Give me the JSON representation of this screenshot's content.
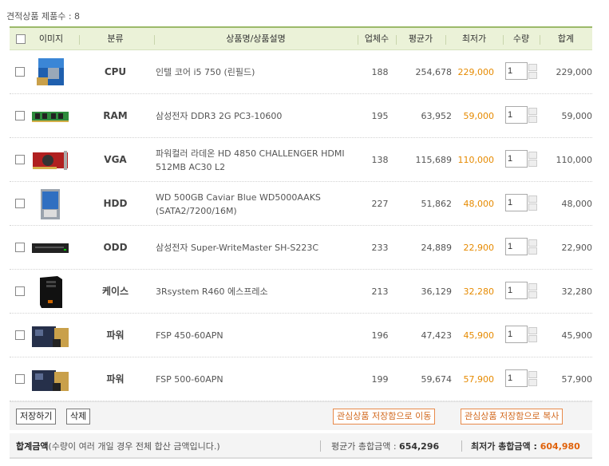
{
  "count_line": "견적상품 제품수 : 8",
  "header": {
    "image": "이미지",
    "category": "분류",
    "product": "상품명/상품설명",
    "vendors": "업체수",
    "avg_price": "평균가",
    "low_price": "최저가",
    "qty": "수량",
    "total": "합계"
  },
  "rows": [
    {
      "category": "CPU",
      "name": "인텔 코어 i5 750 (린필드)",
      "vendors": "188",
      "avg": "254,678",
      "low": "229,000",
      "qty": "1",
      "total": "229,000",
      "thumb": "cpu-box"
    },
    {
      "category": "RAM",
      "name": "삼성전자 DDR3 2G PC3-10600",
      "vendors": "195",
      "avg": "63,952",
      "low": "59,000",
      "qty": "1",
      "total": "59,000",
      "thumb": "ram-stick"
    },
    {
      "category": "VGA",
      "name": "파워컬러 라데온 HD 4850 CHALLENGER HDMI 512MB AC30 L2",
      "vendors": "138",
      "avg": "115,689",
      "low": "110,000",
      "qty": "1",
      "total": "110,000",
      "thumb": "graphics-card"
    },
    {
      "category": "HDD",
      "name": "WD 500GB Caviar Blue WD5000AAKS (SATA2/7200/16M)",
      "vendors": "227",
      "avg": "51,862",
      "low": "48,000",
      "qty": "1",
      "total": "48,000",
      "thumb": "hard-drive"
    },
    {
      "category": "ODD",
      "name": "삼성전자 Super-WriteMaster SH-S223C",
      "vendors": "233",
      "avg": "24,889",
      "low": "22,900",
      "qty": "1",
      "total": "22,900",
      "thumb": "optical-drive"
    },
    {
      "category": "케이스",
      "name": "3Rsystem R460 에스프레소",
      "vendors": "213",
      "avg": "36,129",
      "low": "32,280",
      "qty": "1",
      "total": "32,280",
      "thumb": "pc-case"
    },
    {
      "category": "파워",
      "name": "FSP 450-60APN",
      "vendors": "196",
      "avg": "47,423",
      "low": "45,900",
      "qty": "1",
      "total": "45,900",
      "thumb": "power-supply"
    },
    {
      "category": "파워",
      "name": "FSP 500-60APN",
      "vendors": "199",
      "avg": "59,674",
      "low": "57,900",
      "qty": "1",
      "total": "57,900",
      "thumb": "power-supply"
    }
  ],
  "actions": {
    "save": "저장하기",
    "delete": "삭제",
    "move_to_wishlist": "관심상품 저장함으로 이동",
    "copy_to_wishlist": "관심상품 저장함으로 복사"
  },
  "summary": {
    "label": "합계금액",
    "note": "(수량이 여러 개일 경우 전체 합산 금액입니다.)",
    "avg_label": "평균가 총합금액 : ",
    "avg_value": "654,296",
    "low_label": "최저가 총합금액 : ",
    "low_value": "604,980"
  },
  "colors": {
    "header_bg": "#ebf2d8",
    "header_border": "#9cba6a",
    "low_price": "#e68a00",
    "accent_orange": "#e0620b"
  }
}
